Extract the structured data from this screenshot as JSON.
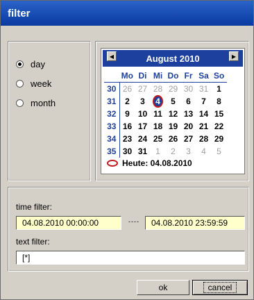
{
  "window": {
    "title": "filter"
  },
  "period": {
    "options": [
      {
        "label": "day",
        "checked": true
      },
      {
        "label": "week",
        "checked": false
      },
      {
        "label": "month",
        "checked": false
      }
    ]
  },
  "calendar": {
    "month_title": "August 2010",
    "prev_icon": "arrow-left-icon",
    "next_icon": "arrow-right-icon",
    "weekdays": [
      "Mo",
      "Di",
      "Mi",
      "Do",
      "Fr",
      "Sa",
      "So"
    ],
    "weeks": [
      {
        "num": "30",
        "days": [
          [
            "26",
            "other"
          ],
          [
            "27",
            "other"
          ],
          [
            "28",
            "other"
          ],
          [
            "29",
            "other"
          ],
          [
            "30",
            "other"
          ],
          [
            "31",
            "other"
          ],
          [
            "1",
            "cur"
          ]
        ]
      },
      {
        "num": "31",
        "days": [
          [
            "2",
            "cur"
          ],
          [
            "3",
            "cur"
          ],
          [
            "4",
            "today"
          ],
          [
            "5",
            "cur"
          ],
          [
            "6",
            "cur"
          ],
          [
            "7",
            "cur"
          ],
          [
            "8",
            "cur"
          ]
        ]
      },
      {
        "num": "32",
        "days": [
          [
            "9",
            "cur"
          ],
          [
            "10",
            "cur"
          ],
          [
            "11",
            "cur"
          ],
          [
            "12",
            "cur"
          ],
          [
            "13",
            "cur"
          ],
          [
            "14",
            "cur"
          ],
          [
            "15",
            "cur"
          ]
        ]
      },
      {
        "num": "33",
        "days": [
          [
            "16",
            "cur"
          ],
          [
            "17",
            "cur"
          ],
          [
            "18",
            "cur"
          ],
          [
            "19",
            "cur"
          ],
          [
            "20",
            "cur"
          ],
          [
            "21",
            "cur"
          ],
          [
            "22",
            "cur"
          ]
        ]
      },
      {
        "num": "34",
        "days": [
          [
            "23",
            "cur"
          ],
          [
            "24",
            "cur"
          ],
          [
            "25",
            "cur"
          ],
          [
            "26",
            "cur"
          ],
          [
            "27",
            "cur"
          ],
          [
            "28",
            "cur"
          ],
          [
            "29",
            "cur"
          ]
        ]
      },
      {
        "num": "35",
        "days": [
          [
            "30",
            "cur"
          ],
          [
            "31",
            "cur"
          ],
          [
            "1",
            "other"
          ],
          [
            "2",
            "other"
          ],
          [
            "3",
            "other"
          ],
          [
            "4",
            "other"
          ],
          [
            "5",
            "other"
          ]
        ]
      }
    ],
    "today_label": "Heute: 04.08.2010"
  },
  "filters": {
    "time_label": "time filter:",
    "time_from": "04.08.2010 00:00:00",
    "time_sep": "----",
    "time_to": "04.08.2010 23:59:59",
    "text_label": "text filter:",
    "text_value": "[*]"
  },
  "buttons": {
    "ok": "ok",
    "cancel": "cancel"
  },
  "colors": {
    "accent": "#1d3f9e",
    "today_ring": "#c21818",
    "field_bg": "#ffffcc"
  }
}
